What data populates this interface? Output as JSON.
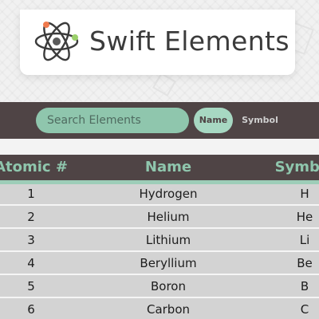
{
  "brand": {
    "title": "Swift Elements",
    "icon": "atom-icon",
    "colors": {
      "nucleus": "#5a5a5a",
      "electron_green": "#9bd06b",
      "electron_orange": "#f07a4d",
      "orbit": "#3b3b3b"
    }
  },
  "toolbar": {
    "search_placeholder": "Search Elements",
    "sort_options": [
      {
        "label": "Name",
        "active": true
      },
      {
        "label": "Symbol",
        "active": false
      }
    ]
  },
  "table": {
    "headers": [
      "Atomic #",
      "Name",
      "Symbol"
    ],
    "rows": [
      {
        "number": "1",
        "name": "Hydrogen",
        "symbol": "H"
      },
      {
        "number": "2",
        "name": "Helium",
        "symbol": "He"
      },
      {
        "number": "3",
        "name": "Lithium",
        "symbol": "Li"
      },
      {
        "number": "4",
        "name": "Beryllium",
        "symbol": "Be"
      },
      {
        "number": "5",
        "name": "Boron",
        "symbol": "B"
      },
      {
        "number": "6",
        "name": "Carbon",
        "symbol": "C"
      }
    ]
  },
  "colors": {
    "dark": "#4f4445",
    "accent": "#8fc6ad",
    "accent_light": "#a7d8c2",
    "row_bg": "#d3d3d3"
  }
}
